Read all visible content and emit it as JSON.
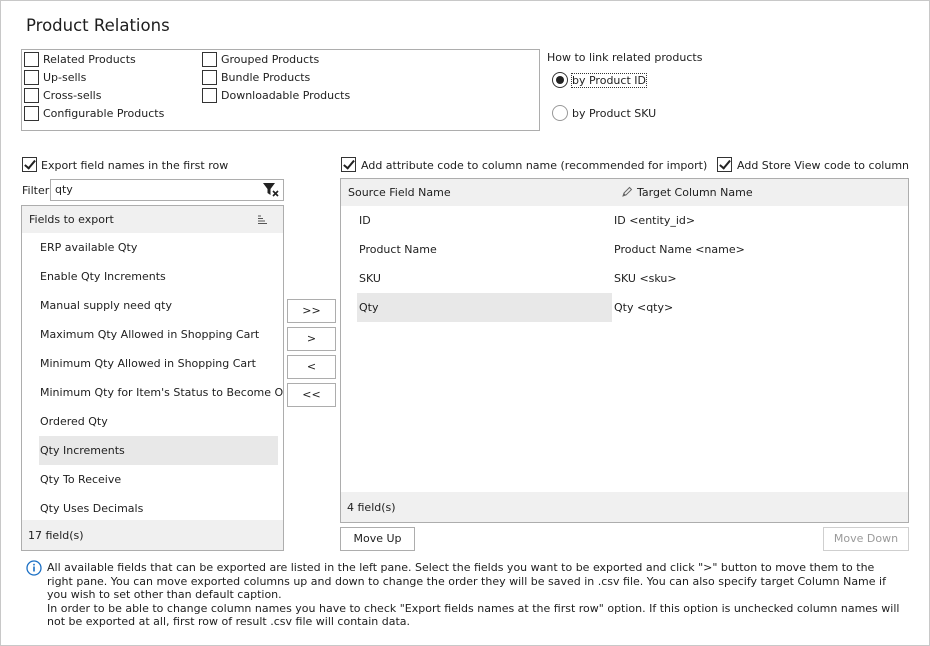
{
  "title": "Product Relations",
  "relations": {
    "col1": [
      "Related Products",
      "Up-sells",
      "Cross-sells",
      "Configurable Products"
    ],
    "col2": [
      "Grouped Products",
      "Bundle Products",
      "Downloadable Products"
    ]
  },
  "link": {
    "label": "How to link related products",
    "opt_id": "by Product ID",
    "opt_sku": "by Product SKU",
    "selected": "by Product ID"
  },
  "options": {
    "export_names": "Export field names in the  first row",
    "add_attr": "Add attribute code to column name (recommended for import)",
    "add_store": "Add Store View code to column nam"
  },
  "filter": {
    "label": "Filter",
    "value": "qty"
  },
  "fields": {
    "header": "Fields to export",
    "items": [
      "ERP available Qty",
      "Enable Qty Increments",
      "Manual supply need qty",
      "Maximum Qty Allowed in Shopping Cart",
      "Minimum Qty Allowed in Shopping Cart",
      "Minimum Qty for Item's Status to Become Out",
      "Ordered Qty",
      "Qty Increments",
      "Qty To Receive",
      "Qty Uses Decimals"
    ],
    "count": "17 field(s)"
  },
  "move_buttons": {
    "add_all": ">>",
    "add": ">",
    "remove": "<",
    "remove_all": "<<"
  },
  "mapping": {
    "source_header": "Source Field Name",
    "target_header": "Target Column Name",
    "rows": [
      {
        "source": "ID",
        "target": "ID <entity_id>"
      },
      {
        "source": "Product Name",
        "target": "Product Name <name>"
      },
      {
        "source": "SKU",
        "target": "SKU <sku>"
      },
      {
        "source": "Qty",
        "target": "Qty <qty>"
      }
    ],
    "count": "4 field(s)"
  },
  "buttons": {
    "move_up": "Move Up",
    "move_down": "Move Down"
  },
  "info": {
    "line1": "All available fields that can be exported are listed in the left pane. Select the fields you want to be exported and click \">\" button to move them to the right pane. You can move exported columns up and down to change the order they will be saved in .csv file. You can also specify target Column Name if you wish to set other than default caption.",
    "line2": "In order to be able to change column names you have to check \"Export fields names at the first row\" option. If this option is unchecked column names will not be exported at all, first row of result .csv file will contain data."
  },
  "colors": {
    "panel_bg": "#f0f0f0",
    "selected_row": "#e8e8e8",
    "info_blue": "#1a6fc4",
    "border": "#adadad"
  }
}
